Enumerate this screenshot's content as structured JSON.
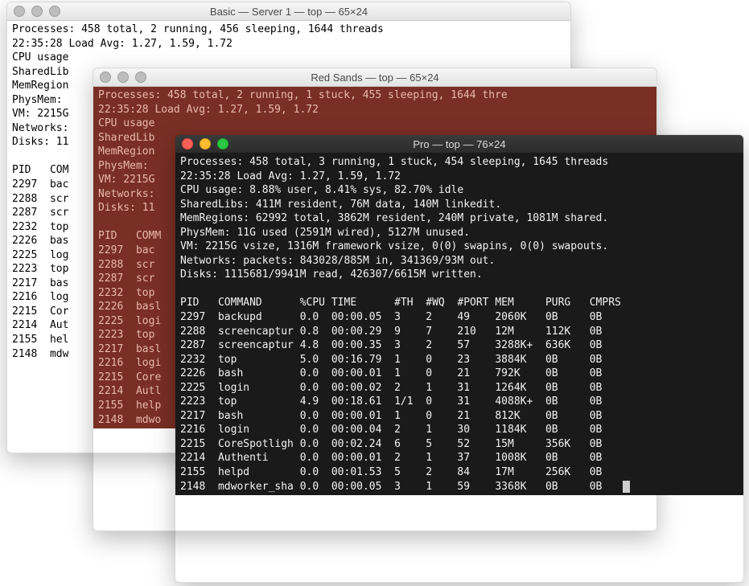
{
  "win_basic": {
    "title": "Basic — Server 1 — top — 65×24",
    "lines": [
      "Processes: 458 total, 2 running, 456 sleeping, 1644 threads",
      "22:35:28 Load Avg: 1.27, 1.59, 1.72",
      "CPU usage",
      "SharedLib",
      "MemRegion",
      "PhysMem:",
      "VM: 2215G",
      "Networks:",
      "Disks: 11",
      "",
      "PID   COM",
      "2297  bac",
      "2288  scr",
      "2287  scr",
      "2232  top",
      "2226  bas",
      "2225  log",
      "2223  top",
      "2217  bas",
      "2216  log",
      "2215  Cor",
      "2214  Aut",
      "2155  hel",
      "2148  mdw"
    ]
  },
  "win_red": {
    "title": "Red Sands — top — 65×24",
    "lines": [
      "Processes: 458 total, 2 running, 1 stuck, 455 sleeping, 1644 thre",
      "22:35:28 Load Avg: 1.27, 1.59, 1.72",
      "CPU usage",
      "SharedLib",
      "MemRegion",
      "PhysMem:",
      "VM: 2215G",
      "Networks:",
      "Disks: 11",
      "",
      "PID   COMM",
      "2297  bac",
      "2288  scr",
      "2287  scr",
      "2232  top",
      "2226  basl",
      "2225  logi",
      "2223  top",
      "2217  basl",
      "2216  logi",
      "2215  Core",
      "2214  Autl",
      "2155  help",
      "2148  mdwo"
    ]
  },
  "win_pro": {
    "title": "Pro — top — 76×24",
    "header_lines": [
      "Processes: 458 total, 3 running, 1 stuck, 454 sleeping, 1645 threads",
      "22:35:28 Load Avg: 1.27, 1.59, 1.72",
      "CPU usage: 8.88% user, 8.41% sys, 82.70% idle",
      "SharedLibs: 411M resident, 76M data, 140M linkedit.",
      "MemRegions: 62992 total, 3862M resident, 240M private, 1081M shared.",
      "PhysMem: 11G used (2591M wired), 5127M unused.",
      "VM: 2215G vsize, 1316M framework vsize, 0(0) swapins, 0(0) swapouts.",
      "Networks: packets: 843028/885M in, 341369/93M out.",
      "Disks: 1115681/9941M read, 426307/6615M written."
    ],
    "columns": [
      "PID",
      "COMMAND",
      "%CPU",
      "TIME",
      "#TH",
      "#WQ",
      "#PORT",
      "MEM",
      "PURG",
      "CMPRS"
    ],
    "rows": [
      [
        "2297",
        "backupd",
        "0.0",
        "00:00.05",
        "3",
        "2",
        "49",
        "2060K",
        "0B",
        "0B"
      ],
      [
        "2288",
        "screencaptur",
        "0.8",
        "00:00.29",
        "9",
        "7",
        "210",
        "12M",
        "112K",
        "0B"
      ],
      [
        "2287",
        "screencaptur",
        "4.8",
        "00:00.35",
        "3",
        "2",
        "57",
        "3288K+",
        "636K",
        "0B"
      ],
      [
        "2232",
        "top",
        "5.0",
        "00:16.79",
        "1",
        "0",
        "23",
        "3884K",
        "0B",
        "0B"
      ],
      [
        "2226",
        "bash",
        "0.0",
        "00:00.01",
        "1",
        "0",
        "21",
        "792K",
        "0B",
        "0B"
      ],
      [
        "2225",
        "login",
        "0.0",
        "00:00.02",
        "2",
        "1",
        "31",
        "1264K",
        "0B",
        "0B"
      ],
      [
        "2223",
        "top",
        "4.9",
        "00:18.61",
        "1/1",
        "0",
        "31",
        "4088K+",
        "0B",
        "0B"
      ],
      [
        "2217",
        "bash",
        "0.0",
        "00:00.01",
        "1",
        "0",
        "21",
        "812K",
        "0B",
        "0B"
      ],
      [
        "2216",
        "login",
        "0.0",
        "00:00.04",
        "2",
        "1",
        "30",
        "1184K",
        "0B",
        "0B"
      ],
      [
        "2215",
        "CoreSpotligh",
        "0.0",
        "00:02.24",
        "6",
        "5",
        "52",
        "15M",
        "356K",
        "0B"
      ],
      [
        "2214",
        "Authenti",
        "0.0",
        "00:00.01",
        "2",
        "1",
        "37",
        "1008K",
        "0B",
        "0B"
      ],
      [
        "2155",
        "helpd",
        "0.0",
        "00:01.53",
        "5",
        "2",
        "84",
        "17M",
        "256K",
        "0B"
      ],
      [
        "2148",
        "mdworker_sha",
        "0.0",
        "00:00.05",
        "3",
        "1",
        "59",
        "3368K",
        "0B",
        "0B"
      ]
    ]
  }
}
